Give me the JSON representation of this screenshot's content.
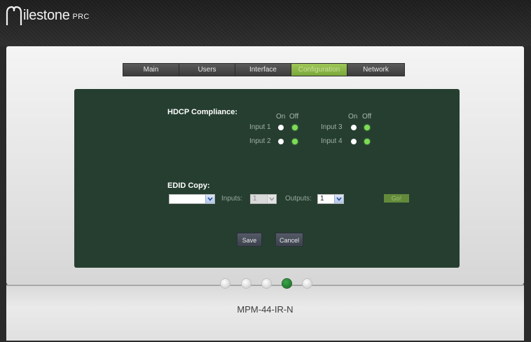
{
  "header": {
    "logo_text": "ilestone",
    "logo_sub": "PRC"
  },
  "tabs": [
    {
      "label": "Main",
      "active": false
    },
    {
      "label": "Users",
      "active": false
    },
    {
      "label": "Interface",
      "active": false
    },
    {
      "label": "Configuration",
      "active": true
    },
    {
      "label": "Network",
      "active": false
    }
  ],
  "hdcp": {
    "title": "HDCP Compliance:",
    "col_on": "On",
    "col_off": "Off",
    "inputs": [
      {
        "label": "Input 1",
        "selected": "off"
      },
      {
        "label": "Input 2",
        "selected": "off"
      },
      {
        "label": "Input 3",
        "selected": "off"
      },
      {
        "label": "Input 4",
        "selected": "off"
      }
    ]
  },
  "edid": {
    "title": "EDID Copy:",
    "source_value": "",
    "inputs_label": "Inputs:",
    "inputs_value": "1",
    "outputs_label": "Outputs:",
    "outputs_value": "1",
    "go_label": "Go!"
  },
  "buttons": {
    "save": "Save",
    "cancel": "Cancel"
  },
  "pager": {
    "total": 5,
    "active_index": 3
  },
  "model": "MPM-44-IR-N",
  "colors": {
    "config_bg": "#253e30",
    "active_tab": "#8ab84a",
    "radio_on": "#7ddc55",
    "pager_active": "#1f7a2c"
  }
}
